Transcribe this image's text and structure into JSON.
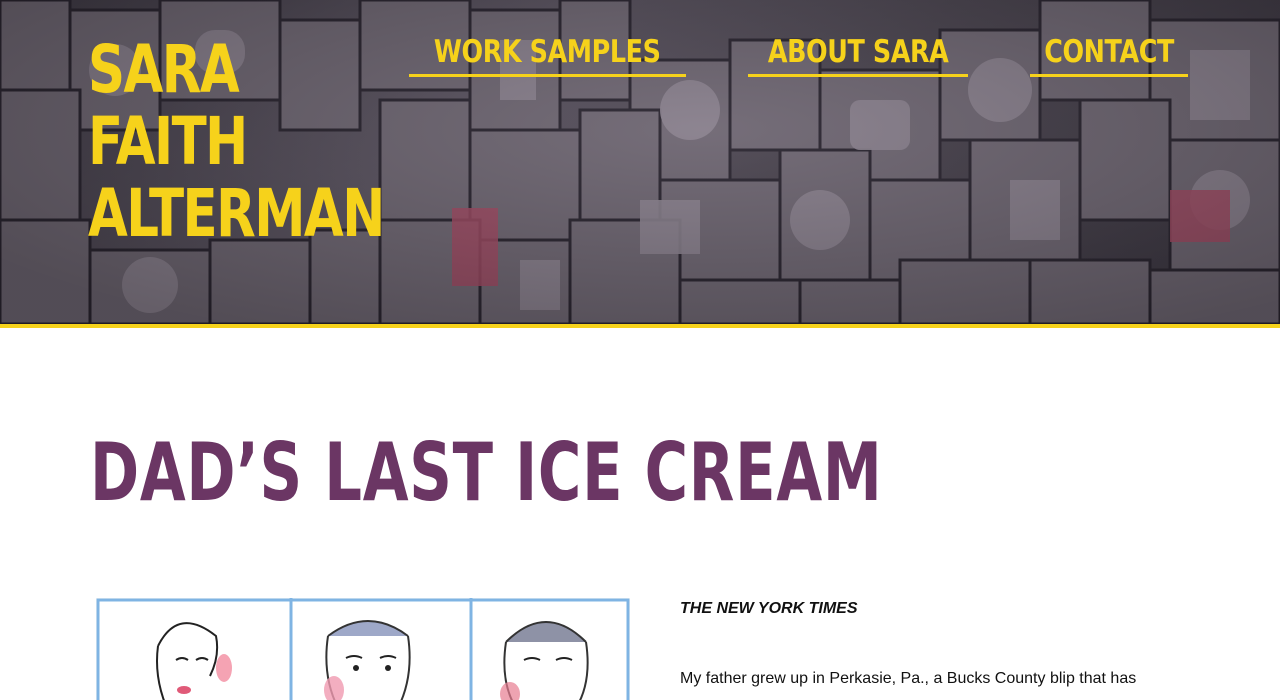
{
  "header": {
    "site_title_lines": [
      "SARA",
      "FAITH",
      "ALTERMAN"
    ],
    "accent_color": "#f6d21b",
    "background_image": "letterpress-type-blocks",
    "nav": [
      {
        "label": "WORK SAMPLES"
      },
      {
        "label": "ABOUT SARA"
      },
      {
        "label": "CONTACT"
      }
    ]
  },
  "article": {
    "title": "DAD’S LAST ICE CREAM",
    "title_color": "#6b3664",
    "illustration": "three-panel-portrait-illustration",
    "source": "THE NEW YORK TIMES",
    "first_line": "My father grew up in Perkasie, Pa., a Bucks County blip that has"
  }
}
